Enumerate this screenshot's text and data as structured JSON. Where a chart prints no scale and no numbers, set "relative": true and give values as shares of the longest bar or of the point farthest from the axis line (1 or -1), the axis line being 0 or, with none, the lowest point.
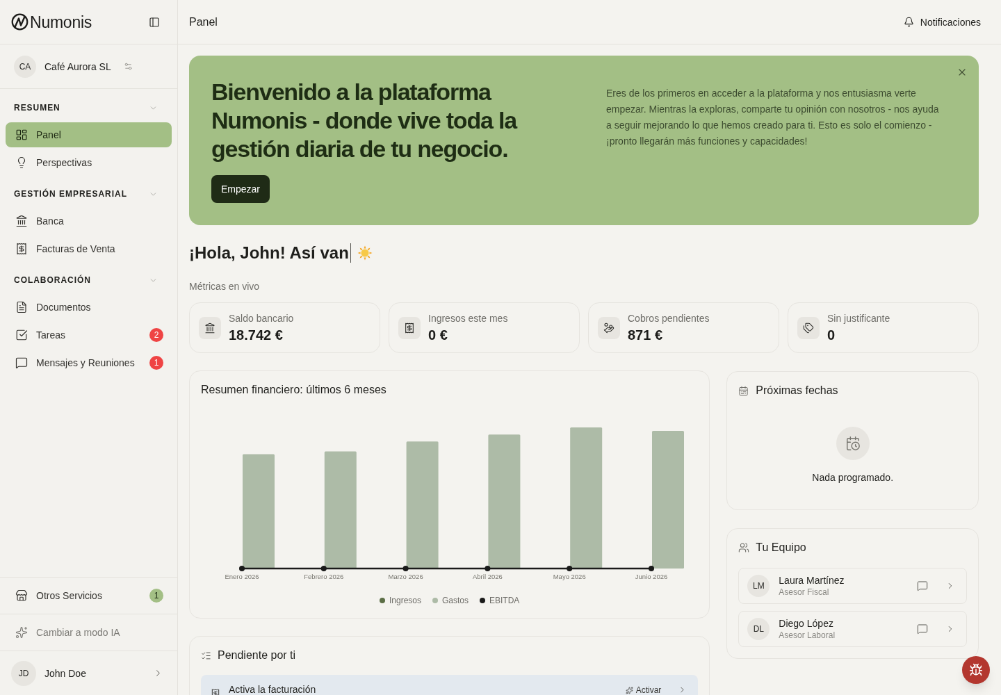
{
  "sidebar": {
    "logo": "Numonis",
    "company": {
      "initials": "CA",
      "name": "Café Aurora SL"
    },
    "sections": [
      {
        "title": "RESUMEN",
        "expanded": true,
        "items": [
          {
            "label": "Panel",
            "selected": true
          },
          {
            "label": "Perspectivas",
            "selected": false
          }
        ]
      },
      {
        "title": "GESTIÓN EMPRESARIAL",
        "expanded": true,
        "items": [
          {
            "label": "Banca",
            "selected": false
          },
          {
            "label": "Facturas de Venta",
            "selected": false
          }
        ]
      },
      {
        "title": "COLABORACIÓN",
        "expanded": true,
        "items": [
          {
            "label": "Documentos",
            "selected": false
          },
          {
            "label": "Tareas",
            "selected": false,
            "badge": "2"
          },
          {
            "label": "Mensajes y Reuniones",
            "selected": false,
            "badge": "1"
          }
        ]
      }
    ],
    "footer_items": [
      {
        "kind": "link",
        "label": "Otros Servicios",
        "badge": "1"
      },
      {
        "kind": "mode-switch",
        "label": "Cambiar a modo IA"
      }
    ],
    "user": {
      "initials": "JD",
      "name": "John Doe"
    }
  },
  "header": {
    "title": "Panel",
    "notifications": "Notificaciones"
  },
  "banner": {
    "title": "Bienvenido a la plataforma Numonis - donde vive toda la gestión diaria de tu negocio.",
    "text": "Eres de los primeros en acceder a la plataforma y nos entusiasma verte empezar. Mientras la exploras, comparte tu opinión con nosotros - nos ayuda a seguir mejorando lo que hemos creado para ti. Esto es solo el comienzo - ¡pronto llegarán más funciones y capacidades!",
    "button": "Empezar",
    "dismissible": true
  },
  "greeting": {
    "text": "¡Hola, John! Así van",
    "typing_cursor": true
  },
  "metrics": {
    "title": "Métricas en vivo",
    "cards": [
      {
        "label": "Saldo bancario",
        "value": "18.742 €"
      },
      {
        "label": "Ingresos este mes",
        "value": "0 €"
      },
      {
        "label": "Cobros pendientes",
        "value": "871 €"
      },
      {
        "label": "Sin justificante",
        "value": "0"
      }
    ]
  },
  "chart": {
    "chart_data": {
      "type": "bar",
      "title": "Resumen financiero: últimos 6 meses",
      "relative": true,
      "legend": "bottom",
      "categories": [
        "Enero 2026",
        "Febrero 2026",
        "Marzo 2026",
        "Abril 2026",
        "Mayo 2026",
        "Junio 2026"
      ],
      "series": [
        {
          "name": "Ingresos",
          "type": "bar",
          "color": "#5b6e46",
          "values": [
            0,
            0,
            0,
            0,
            0,
            0
          ]
        },
        {
          "name": "Gastos",
          "type": "bar",
          "color": "#adbba7",
          "values": [
            0.81,
            0.83,
            0.9,
            0.95,
            1,
            0.975
          ]
        },
        {
          "name": "EBITDA",
          "type": "line",
          "marker": "circle",
          "color": "#1a1a1a",
          "values": [
            0,
            0,
            0,
            0,
            0,
            0
          ]
        }
      ]
    }
  },
  "pending": {
    "title": "Pendiente por ti",
    "items": [
      {
        "title": "Activa la facturación",
        "action": "Activar"
      }
    ]
  },
  "upcoming": {
    "title": "Próximas fechas",
    "empty_text": "Nada programado."
  },
  "team": {
    "title": "Tu Equipo",
    "members": [
      {
        "initials": "LM",
        "name": "Laura Martínez",
        "role": "Asesor Fiscal"
      },
      {
        "initials": "DL",
        "name": "Diego López",
        "role": "Asesor Laboral"
      }
    ]
  }
}
